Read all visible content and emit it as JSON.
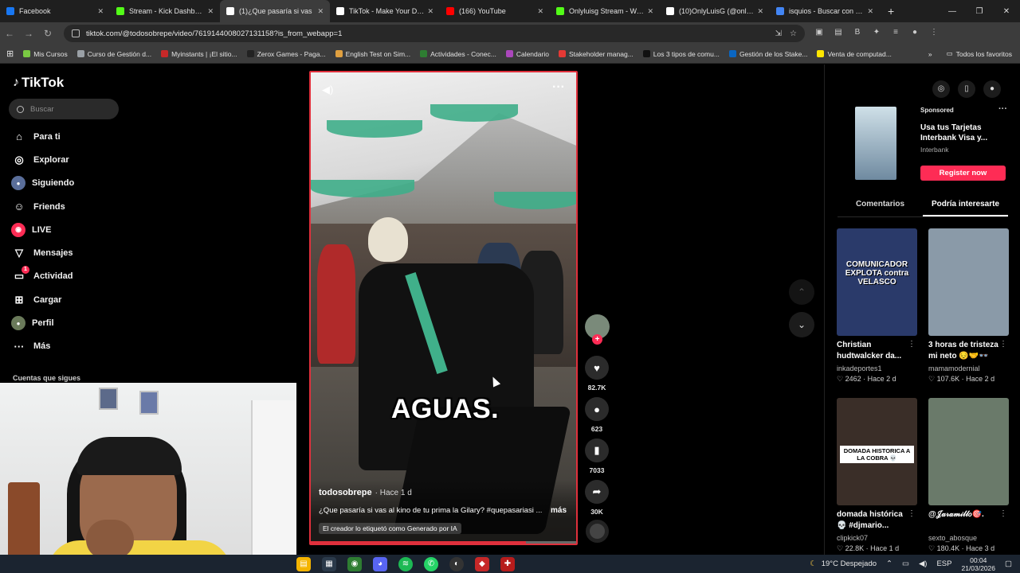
{
  "browser": {
    "tabs": [
      {
        "label": "Facebook",
        "color": "#1877f2"
      },
      {
        "label": "Stream - Kick Dashboard",
        "color": "#53fc18"
      },
      {
        "label": "(1)¿Que pasaría si vas",
        "color": "#ffffff",
        "active": true
      },
      {
        "label": "TikTok - Make Your Day",
        "color": "#ffffff"
      },
      {
        "label": "(166) YouTube",
        "color": "#ff0000"
      },
      {
        "label": "Onlyluisg Stream - Watch",
        "color": "#53fc18"
      },
      {
        "label": "(10)OnlyLuisG (@onlyluis",
        "color": "#ffffff"
      },
      {
        "label": "isquios - Buscar con Goo",
        "color": "#4285f4"
      }
    ],
    "new_tab": "+",
    "url": "tiktok.com/@todosobrepe/video/7619144008027131158?is_from_webapp=1",
    "bookmarks": [
      {
        "label": "Mis Cursos",
        "color": "#7ac943"
      },
      {
        "label": "Curso de Gestión d...",
        "color": "#9aa0a6"
      },
      {
        "label": "Myinstants | ¡El sitio...",
        "color": "#c62828"
      },
      {
        "label": "Zerox Games - Paga...",
        "color": "#222222"
      },
      {
        "label": "English Test on Sim...",
        "color": "#e0a040"
      },
      {
        "label": "Actividades - Conec...",
        "color": "#2e7d32"
      },
      {
        "label": "Calendario",
        "color": "#ab47bc"
      },
      {
        "label": "Stakeholder manag...",
        "color": "#e53935"
      },
      {
        "label": "Los 3 tipos de comu...",
        "color": "#111111"
      },
      {
        "label": "Gestión de los Stake...",
        "color": "#0a66c2"
      },
      {
        "label": "Venta de computad...",
        "color": "#ffe600"
      }
    ],
    "all_bookmarks": "Todos los favoritos"
  },
  "tiktok": {
    "logo": "TikTok",
    "search_placeholder": "Buscar",
    "nav": [
      {
        "label": "Para ti",
        "icon": "home-icon",
        "glyph": "⌂"
      },
      {
        "label": "Explorar",
        "icon": "compass-icon",
        "glyph": "◎"
      },
      {
        "label": "Siguiendo",
        "icon": "following-avatar-icon",
        "glyph": "●"
      },
      {
        "label": "Friends",
        "icon": "friends-icon",
        "glyph": "☺"
      },
      {
        "label": "LIVE",
        "icon": "live-icon",
        "glyph": "◉"
      },
      {
        "label": "Mensajes",
        "icon": "messages-icon",
        "glyph": "▽"
      },
      {
        "label": "Actividad",
        "icon": "activity-icon",
        "glyph": "▭"
      },
      {
        "label": "Cargar",
        "icon": "upload-icon",
        "glyph": "⊞"
      },
      {
        "label": "Perfil",
        "icon": "profile-icon",
        "glyph": "●"
      },
      {
        "label": "Más",
        "icon": "more-icon",
        "glyph": "···"
      }
    ],
    "activity_badge": "1",
    "following_header": "Cuentas que sigues",
    "video": {
      "overlay_text": "AGUAS.",
      "author": "todosobrepe",
      "time": "· Hace 1 d",
      "description": "¿Que pasaría si vas al kino de tu prima la Gilary? #quepasariasi ...",
      "more": "más",
      "ai_label": "El creador lo etiquetó como Generado por IA",
      "progress": 0.8
    },
    "actions": {
      "likes": "82.7K",
      "comments": "623",
      "saves": "7033",
      "shares": "30K",
      "follow": "+"
    },
    "sponsored": {
      "label": "Sponsored",
      "title": "Usa tus Tarjetas Interbank Visa y...",
      "brand": "Interbank",
      "cta": "Register now"
    },
    "right_tabs": [
      "Comentarios",
      "Podría interesarte"
    ],
    "cards": [
      {
        "title": "Christian hudtwalcker da...",
        "author": "inkadeportes1",
        "likes": "♡ 2462",
        "time": "· Hace 2 d",
        "thumb_text": "COMUNICADOR EXPLOTA contra VELASCO",
        "bg": "#2a3a6a"
      },
      {
        "title": "3 horas de tristeza mi neto 😔🤝👓",
        "author": "mamamodernial",
        "likes": "♡ 107.6K",
        "time": "· Hace 2 d",
        "thumb_text": "",
        "bg": "#8a9aa8"
      },
      {
        "title": "domada histórica 💀 #djmario...",
        "author": "clipkick07",
        "likes": "♡ 22.8K",
        "time": "· Hace 1 d",
        "thumb_text": "DOMADA HISTORICA A LA COBRA 💀",
        "bg": "#3a2e28"
      },
      {
        "title": "@𝒥𝒶𝓇𝒶𝓂𝒾𝓁𝓁𝑜🎯.",
        "author": "sexto_abosque",
        "likes": "♡ 180.4K",
        "time": "· Hace 3 d",
        "thumb_text": "",
        "bg": "#6a7a6a"
      }
    ]
  },
  "taskbar": {
    "weather": "19°C Despejado",
    "lang": "ESP",
    "time": "00:04",
    "date": "21/03/2026"
  }
}
